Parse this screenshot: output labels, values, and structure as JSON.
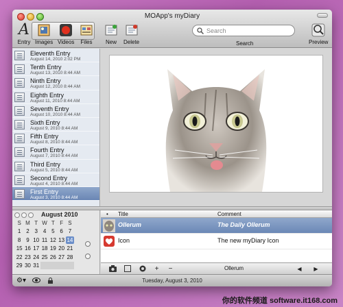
{
  "window": {
    "title": "MOApp's myDiary"
  },
  "toolbar": {
    "entry_label": "Entry",
    "images_label": "Images",
    "videos_label": "Videos",
    "files_label": "Files",
    "new_label": "New",
    "delete_label": "Delete",
    "search_placeholder": "Search",
    "search_label": "Search",
    "preview_label": "Preview"
  },
  "sidebar": {
    "entries": [
      {
        "title": "Eleventh Entry",
        "date": "August 14, 2010 2:02 PM"
      },
      {
        "title": "Tenth Entry",
        "date": "August 13, 2010 8:44 AM"
      },
      {
        "title": "Ninth Entry",
        "date": "August 12, 2010 8:44 AM"
      },
      {
        "title": "Eighth Entry",
        "date": "August 11, 2010 8:44 AM"
      },
      {
        "title": "Seventh Entry",
        "date": "August 10, 2010 8:44 AM"
      },
      {
        "title": "Sixth Entry",
        "date": "August 9, 2010 8:44 AM"
      },
      {
        "title": "Fifth Entry",
        "date": "August 8, 2010 8:44 AM"
      },
      {
        "title": "Fourth Entry",
        "date": "August 7, 2010 8:44 AM"
      },
      {
        "title": "Third Entry",
        "date": "August 5, 2010 8:44 AM"
      },
      {
        "title": "Second Entry",
        "date": "August 4, 2010 8:44 AM"
      },
      {
        "title": "First Entry",
        "date": "August 3, 2010 8:44 AM"
      }
    ],
    "selected_index": 10
  },
  "calendar": {
    "month": "August 2010",
    "weekdays": [
      "S",
      "M",
      "T",
      "W",
      "T",
      "F",
      "S"
    ],
    "days": [
      "1",
      "2",
      "3",
      "4",
      "5",
      "6",
      "7",
      "8",
      "9",
      "10",
      "11",
      "12",
      "13",
      "14",
      "15",
      "16",
      "17",
      "18",
      "19",
      "20",
      "21",
      "22",
      "23",
      "24",
      "25",
      "26",
      "27",
      "28",
      "29",
      "30",
      "31"
    ],
    "today": "14"
  },
  "list": {
    "columns": {
      "dot": "•",
      "title": "Title",
      "comment": "Comment"
    },
    "rows": [
      {
        "title": "Ollerum",
        "comment": "The Daily Ollerum",
        "icon": "cat-thumbnail-icon"
      },
      {
        "title": "Icon",
        "comment": "The new myDiary Icon",
        "icon": "heart-icon"
      }
    ],
    "selected_index": 0,
    "current_item": "Ollerum"
  },
  "status": {
    "date": "Tuesday, August 3, 2010"
  },
  "watermark": "你的软件频道 software.it168.com",
  "colors": {
    "selection": "#7890bd",
    "desktop": "#c77ac2"
  }
}
